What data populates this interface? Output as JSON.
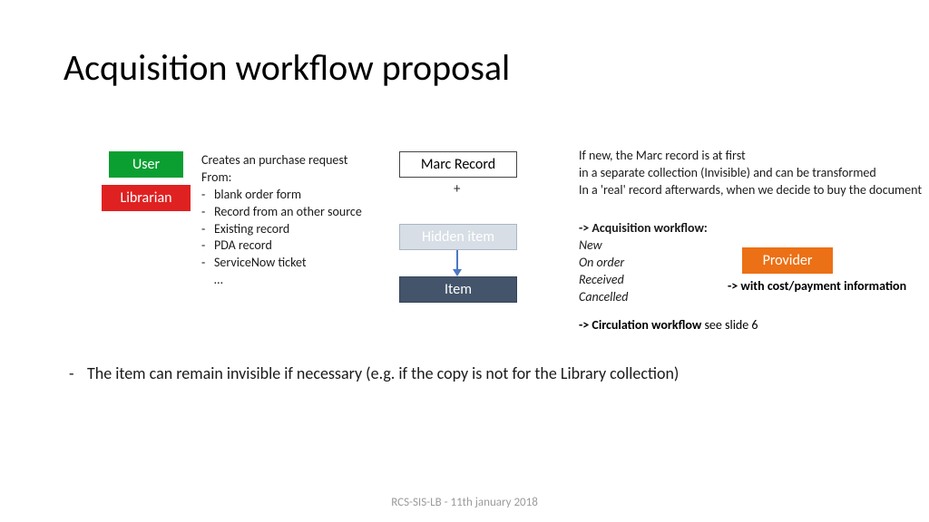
{
  "title": "Acquisition workflow proposal",
  "boxes": {
    "user": "User",
    "librarian": "Librarian",
    "marc": "Marc Record",
    "plus": "+",
    "hidden_item": "Hidden item",
    "item": "Item",
    "provider": "Provider"
  },
  "purchase": {
    "heading": "Creates an purchase request",
    "from_label": "From:",
    "items": [
      "blank order form",
      "Record from an other source",
      "Existing record",
      "PDA record",
      "ServiceNow ticket"
    ],
    "ellipsis": "…"
  },
  "marc_note": {
    "l1": "If new, the Marc record is at first",
    "l2": "in a separate collection (Invisible) and can be transformed",
    "l3": "In a 'real' record afterwards, when we decide to buy the document"
  },
  "acq": {
    "head": "-> Acquisition workflow:",
    "states": [
      "New",
      "On order",
      "Received",
      "Cancelled"
    ]
  },
  "cost_note": "-> with cost/payment information",
  "circ": {
    "bold": "-> Circulation workflow",
    "rest": " see slide 6"
  },
  "bottom_note": "The item can remain invisible if necessary (e.g. if the copy is not for the Library collection)",
  "footer": "RCS-SIS-LB - 11th january 2018"
}
